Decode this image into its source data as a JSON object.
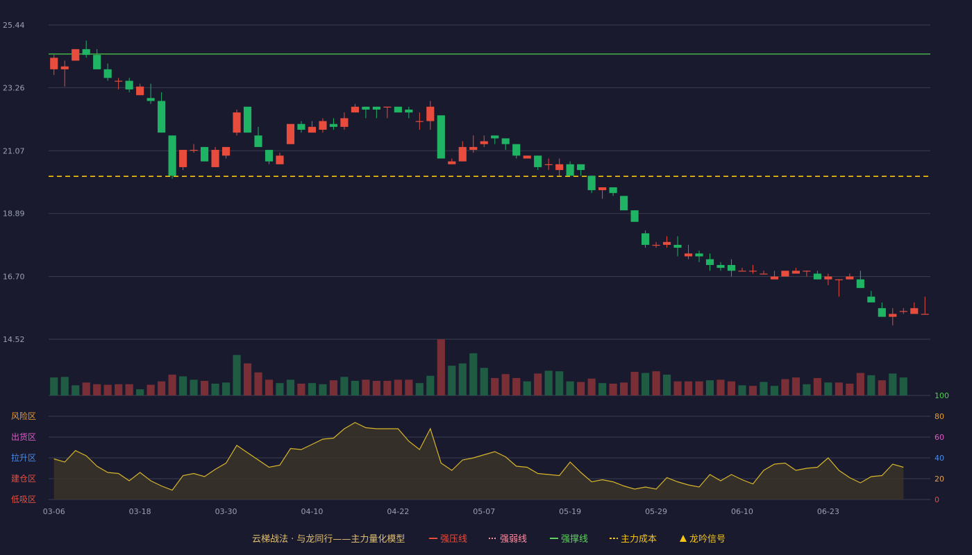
{
  "chart_data": {
    "type": "candlestick",
    "title": "云梯战法 · 与龙同行——主力量化模型",
    "y_ticks": [
      "25.44",
      "23.26",
      "21.07",
      "18.89",
      "16.70",
      "14.52"
    ],
    "ylim": [
      14.52,
      25.44
    ],
    "x_ticks": [
      "03-06",
      "03-18",
      "03-30",
      "04-10",
      "04-22",
      "05-07",
      "05-19",
      "05-29",
      "06-10",
      "06-23"
    ],
    "x_tick_idx": [
      0,
      8,
      16,
      24,
      32,
      40,
      48,
      56,
      64,
      72
    ],
    "lines": {
      "pressure": 24.43,
      "support": 24.43,
      "cost": 20.18
    },
    "ohlc": [
      [
        23.9,
        24.4,
        23.7,
        24.3
      ],
      [
        23.9,
        24.2,
        23.3,
        24.0
      ],
      [
        24.2,
        24.6,
        24.2,
        24.6
      ],
      [
        24.6,
        24.9,
        24.3,
        24.4
      ],
      [
        24.4,
        24.6,
        23.9,
        23.9
      ],
      [
        23.9,
        24.1,
        23.5,
        23.6
      ],
      [
        23.5,
        23.6,
        23.2,
        23.5
      ],
      [
        23.5,
        23.6,
        23.1,
        23.2
      ],
      [
        23.0,
        23.4,
        23.0,
        23.3
      ],
      [
        22.9,
        23.4,
        22.7,
        22.8
      ],
      [
        22.8,
        23.1,
        21.7,
        21.7
      ],
      [
        21.6,
        21.6,
        20.1,
        20.2
      ],
      [
        20.5,
        21.1,
        20.4,
        21.1
      ],
      [
        21.1,
        21.3,
        21.0,
        21.1
      ],
      [
        21.2,
        21.2,
        20.7,
        20.7
      ],
      [
        20.5,
        21.2,
        20.5,
        21.1
      ],
      [
        20.9,
        21.2,
        20.8,
        21.2
      ],
      [
        21.7,
        22.5,
        21.6,
        22.4
      ],
      [
        22.6,
        22.6,
        21.7,
        21.7
      ],
      [
        21.6,
        21.9,
        21.2,
        21.2
      ],
      [
        21.1,
        21.1,
        20.6,
        20.7
      ],
      [
        20.6,
        21.0,
        20.6,
        20.9
      ],
      [
        21.3,
        22.0,
        21.3,
        22.0
      ],
      [
        22.0,
        22.1,
        21.7,
        21.8
      ],
      [
        21.7,
        22.1,
        21.7,
        21.9
      ],
      [
        21.8,
        22.2,
        21.7,
        22.1
      ],
      [
        22.0,
        22.2,
        21.8,
        21.9
      ],
      [
        21.9,
        22.4,
        21.8,
        22.2
      ],
      [
        22.4,
        22.7,
        22.4,
        22.6
      ],
      [
        22.6,
        22.6,
        22.2,
        22.5
      ],
      [
        22.6,
        22.6,
        22.2,
        22.5
      ],
      [
        22.6,
        22.6,
        22.2,
        22.6
      ],
      [
        22.6,
        22.6,
        22.4,
        22.4
      ],
      [
        22.5,
        22.6,
        22.2,
        22.4
      ],
      [
        22.1,
        22.4,
        21.8,
        22.1
      ],
      [
        22.1,
        22.8,
        21.8,
        22.6
      ],
      [
        22.3,
        22.3,
        20.8,
        20.8
      ],
      [
        20.6,
        20.8,
        20.6,
        20.7
      ],
      [
        20.7,
        21.4,
        20.7,
        21.2
      ],
      [
        21.1,
        21.6,
        21.0,
        21.2
      ],
      [
        21.3,
        21.6,
        21.2,
        21.4
      ],
      [
        21.6,
        21.6,
        21.3,
        21.5
      ],
      [
        21.5,
        21.5,
        21.1,
        21.3
      ],
      [
        21.3,
        21.3,
        20.8,
        20.9
      ],
      [
        20.8,
        20.9,
        20.8,
        20.9
      ],
      [
        20.9,
        20.9,
        20.4,
        20.5
      ],
      [
        20.6,
        20.8,
        20.4,
        20.6
      ],
      [
        20.4,
        20.8,
        20.2,
        20.6
      ],
      [
        20.6,
        20.7,
        20.2,
        20.2
      ],
      [
        20.6,
        20.6,
        20.2,
        20.4
      ],
      [
        20.2,
        20.2,
        19.6,
        19.7
      ],
      [
        19.7,
        19.8,
        19.4,
        19.8
      ],
      [
        19.8,
        19.8,
        19.5,
        19.6
      ],
      [
        19.5,
        19.5,
        19.0,
        19.0
      ],
      [
        19.0,
        19.0,
        18.6,
        18.6
      ],
      [
        18.2,
        18.3,
        17.7,
        17.8
      ],
      [
        17.8,
        17.9,
        17.7,
        17.8
      ],
      [
        17.8,
        18.1,
        17.7,
        17.9
      ],
      [
        17.8,
        18.1,
        17.4,
        17.7
      ],
      [
        17.4,
        17.8,
        17.3,
        17.5
      ],
      [
        17.5,
        17.6,
        17.2,
        17.4
      ],
      [
        17.3,
        17.5,
        16.9,
        17.1
      ],
      [
        17.1,
        17.2,
        16.9,
        17.0
      ],
      [
        17.1,
        17.3,
        16.7,
        16.9
      ],
      [
        16.9,
        17.0,
        16.9,
        16.9
      ],
      [
        16.9,
        17.1,
        16.8,
        16.9
      ],
      [
        16.8,
        16.9,
        16.8,
        16.8
      ],
      [
        16.6,
        16.9,
        16.6,
        16.7
      ],
      [
        16.7,
        16.9,
        16.7,
        16.9
      ],
      [
        16.8,
        17.0,
        16.8,
        16.9
      ],
      [
        16.9,
        16.9,
        16.7,
        16.9
      ],
      [
        16.8,
        16.9,
        16.6,
        16.6
      ],
      [
        16.6,
        16.8,
        16.4,
        16.7
      ],
      [
        16.6,
        16.6,
        16.0,
        16.6
      ],
      [
        16.6,
        16.8,
        16.6,
        16.7
      ],
      [
        16.6,
        16.9,
        16.4,
        16.3
      ],
      [
        16.0,
        16.2,
        15.8,
        15.8
      ],
      [
        15.6,
        15.8,
        15.3,
        15.3
      ],
      [
        15.3,
        15.6,
        15.0,
        15.4
      ],
      [
        15.5,
        15.6,
        15.4,
        15.5
      ],
      [
        15.4,
        15.8,
        15.4,
        15.6
      ],
      [
        15.4,
        16.0,
        15.4,
        15.4
      ]
    ],
    "volume": [
      [
        32,
        "g"
      ],
      [
        33,
        "g"
      ],
      [
        18,
        "g"
      ],
      [
        23,
        "r"
      ],
      [
        20,
        "r"
      ],
      [
        19,
        "r"
      ],
      [
        20,
        "r"
      ],
      [
        20,
        "r"
      ],
      [
        11,
        "g"
      ],
      [
        19,
        "r"
      ],
      [
        25,
        "r"
      ],
      [
        37,
        "r"
      ],
      [
        34,
        "g"
      ],
      [
        28,
        "g"
      ],
      [
        26,
        "r"
      ],
      [
        21,
        "g"
      ],
      [
        23,
        "g"
      ],
      [
        72,
        "g"
      ],
      [
        57,
        "r"
      ],
      [
        41,
        "r"
      ],
      [
        28,
        "r"
      ],
      [
        22,
        "g"
      ],
      [
        28,
        "g"
      ],
      [
        21,
        "r"
      ],
      [
        22,
        "g"
      ],
      [
        20,
        "g"
      ],
      [
        27,
        "r"
      ],
      [
        33,
        "g"
      ],
      [
        26,
        "g"
      ],
      [
        28,
        "r"
      ],
      [
        26,
        "r"
      ],
      [
        26,
        "r"
      ],
      [
        28,
        "r"
      ],
      [
        28,
        "r"
      ],
      [
        22,
        "g"
      ],
      [
        35,
        "g"
      ],
      [
        100,
        "r"
      ],
      [
        53,
        "g"
      ],
      [
        57,
        "g"
      ],
      [
        75,
        "g"
      ],
      [
        49,
        "g"
      ],
      [
        31,
        "r"
      ],
      [
        38,
        "r"
      ],
      [
        31,
        "r"
      ],
      [
        25,
        "g"
      ],
      [
        39,
        "r"
      ],
      [
        44,
        "g"
      ],
      [
        43,
        "g"
      ],
      [
        25,
        "g"
      ],
      [
        24,
        "r"
      ],
      [
        30,
        "r"
      ],
      [
        22,
        "g"
      ],
      [
        21,
        "r"
      ],
      [
        23,
        "r"
      ],
      [
        42,
        "r"
      ],
      [
        40,
        "g"
      ],
      [
        43,
        "r"
      ],
      [
        37,
        "g"
      ],
      [
        25,
        "r"
      ],
      [
        25,
        "r"
      ],
      [
        25,
        "r"
      ],
      [
        27,
        "g"
      ],
      [
        28,
        "r"
      ],
      [
        25,
        "r"
      ],
      [
        18,
        "g"
      ],
      [
        17,
        "r"
      ],
      [
        24,
        "g"
      ],
      [
        17,
        "g"
      ],
      [
        29,
        "r"
      ],
      [
        32,
        "r"
      ],
      [
        20,
        "g"
      ],
      [
        31,
        "r"
      ],
      [
        23,
        "g"
      ],
      [
        23,
        "r"
      ],
      [
        21,
        "r"
      ],
      [
        40,
        "r"
      ],
      [
        36,
        "g"
      ],
      [
        27,
        "r"
      ],
      [
        39,
        "g"
      ],
      [
        32,
        "g"
      ]
    ],
    "indicator": {
      "ylim": [
        0,
        100
      ],
      "right_ticks": [
        "100",
        "80",
        "60",
        "40",
        "20",
        "0"
      ],
      "zones": [
        "风险区",
        "出货区",
        "拉升区",
        "建仓区",
        "低吸区"
      ],
      "values": [
        39,
        36,
        47,
        42,
        32,
        26,
        25,
        18,
        26,
        18,
        13,
        9,
        23,
        25,
        22,
        29,
        35,
        52,
        45,
        38,
        31,
        33,
        49,
        48,
        53,
        58,
        59,
        68,
        74,
        69,
        68,
        68,
        68,
        56,
        48,
        68,
        35,
        28,
        38,
        40,
        43,
        46,
        41,
        32,
        31,
        25,
        24,
        23,
        36,
        26,
        17,
        19,
        17,
        13,
        10,
        12,
        10,
        21,
        17,
        14,
        12,
        24,
        18,
        24,
        19,
        15,
        28,
        34,
        35,
        28,
        30,
        31,
        40,
        28,
        21,
        16,
        22,
        23,
        34,
        31
      ]
    },
    "legend": [
      {
        "label": "云梯战法 · 与龙同行——主力量化模型",
        "color": "#e0c070",
        "kind": "text"
      },
      {
        "label": "强压线",
        "color": "#e84c3d",
        "kind": "solid"
      },
      {
        "label": "强弱线",
        "color": "#ff8fa3",
        "kind": "dotted"
      },
      {
        "label": "强撑线",
        "color": "#5dd35d",
        "kind": "solid"
      },
      {
        "label": "主力成本",
        "color": "#f5c518",
        "kind": "dashed"
      },
      {
        "label": "龙吟信号",
        "color": "#f5c518",
        "kind": "triangle"
      }
    ],
    "colors": {
      "up": "#e84c3d",
      "down": "#1fb464",
      "vol_up": "#7a2f36",
      "vol_down": "#1f5c43",
      "grid": "#3a3d50",
      "text": "#9aa0b0",
      "indicator_line": "#d8b62b",
      "support_line": "#4cd14c",
      "cost_line": "#f5c518"
    }
  }
}
